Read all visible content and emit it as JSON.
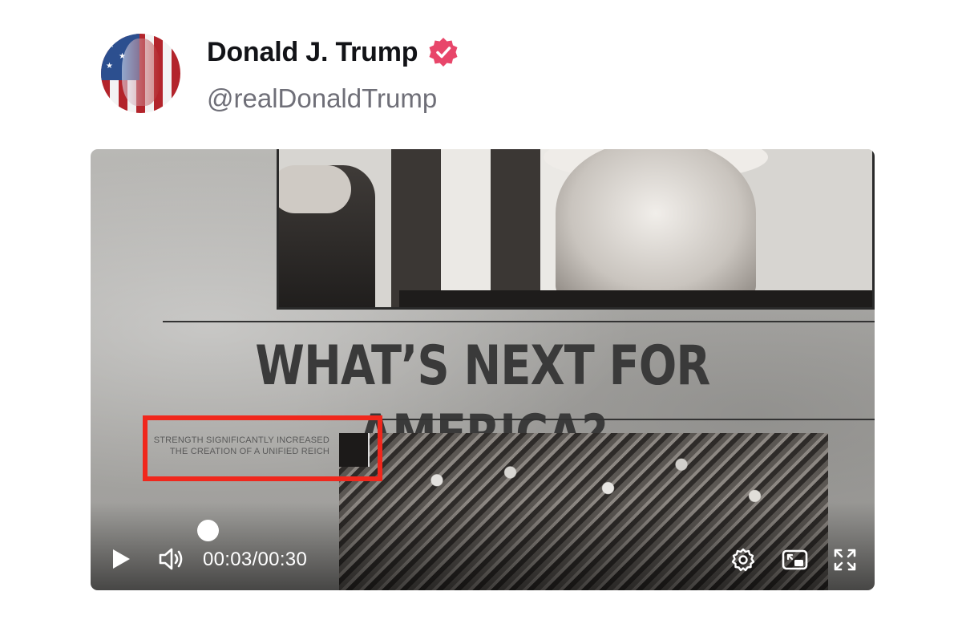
{
  "profile": {
    "name": "Donald J. Trump",
    "handle": "@realDonaldTrump",
    "verified_color": "#e8466a"
  },
  "video": {
    "headline": "WHAT’S NEXT FOR AMERICA?",
    "caption_line1": "STRENGTH SIGNIFICANTLY INCREASED",
    "caption_line2": "THE CREATION OF A UNIFIED REICH",
    "highlight_color": "#f0271c",
    "current_time": "00:03",
    "separator": "/",
    "duration": "00:30",
    "progress": 0.1
  },
  "icons": {
    "play": "play-icon",
    "volume": "volume-icon",
    "settings": "gear-icon",
    "pip": "picture-in-picture-icon",
    "fullscreen": "fullscreen-icon",
    "verified": "verified-badge-icon"
  }
}
